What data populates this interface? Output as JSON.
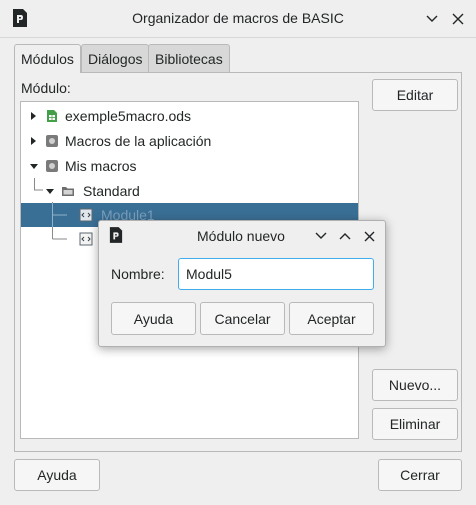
{
  "window": {
    "title": "Organizador de macros de BASIC",
    "icon": "libreoffice-doc-icon"
  },
  "tabs": [
    {
      "label": "Módulos",
      "active": true
    },
    {
      "label": "Diálogos",
      "active": false
    },
    {
      "label": "Bibliotecas",
      "active": false
    }
  ],
  "module_label": "Módulo:",
  "tree": {
    "items": [
      {
        "label": "exemple5macro.ods",
        "icon": "spreadsheet-icon"
      },
      {
        "label": "Macros de la aplicación",
        "icon": "library-icon"
      },
      {
        "label": "Mis macros",
        "icon": "library-icon"
      },
      {
        "label": "Standard",
        "icon": "folder-icon"
      },
      {
        "label": "Module1",
        "icon": "basic-module-icon",
        "selected": true
      },
      {
        "label": "",
        "icon": "basic-module-icon"
      }
    ]
  },
  "buttons": {
    "edit": "Editar",
    "new": "Nuevo...",
    "delete": "Eliminar",
    "help": "Ayuda",
    "close": "Cerrar"
  },
  "modal": {
    "title": "Módulo nuevo",
    "name_label": "Nombre:",
    "name_value": "Modul5",
    "help": "Ayuda",
    "cancel": "Cancelar",
    "accept": "Aceptar"
  },
  "colors": {
    "accent": "#3daee9",
    "selection": "#3a6f95"
  }
}
